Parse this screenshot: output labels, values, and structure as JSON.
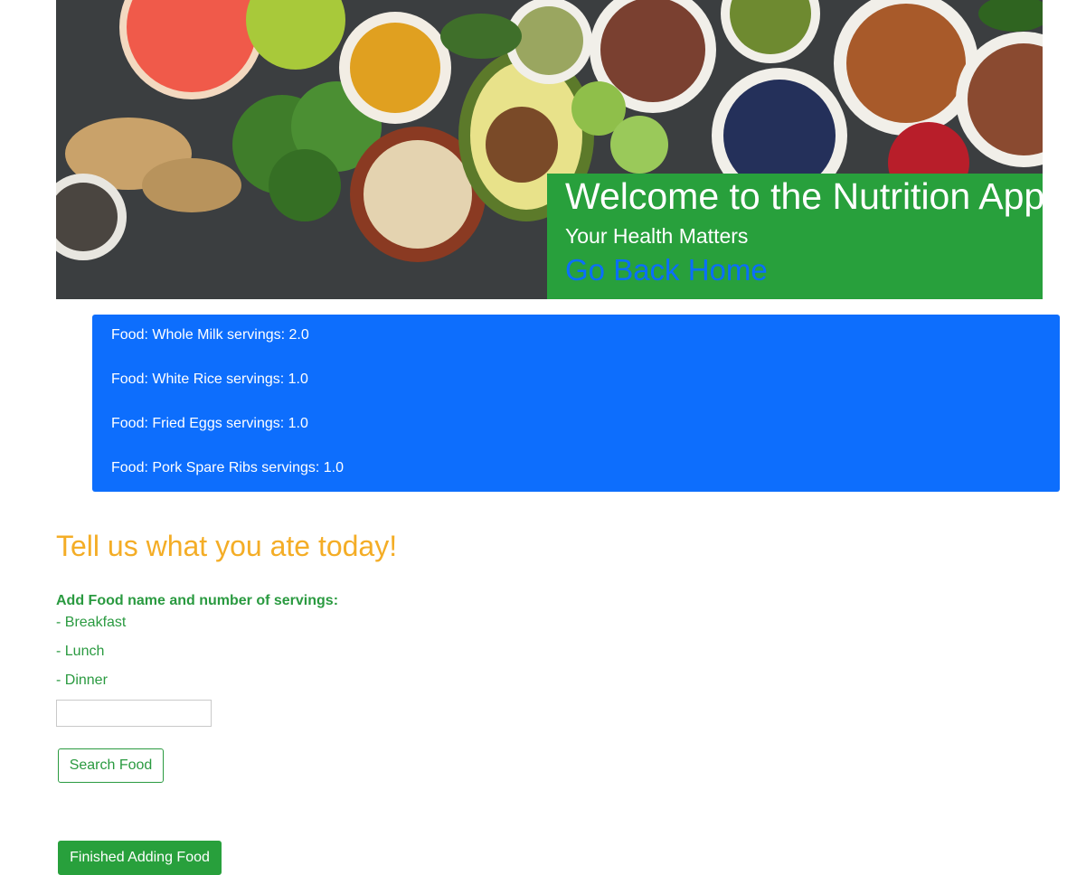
{
  "hero": {
    "image_description": "Assortment of healthy foods: grapefruit, apple, turmeric, spinach, greens powder, flax seeds, mung beans, almonds, broccoli, oats, avocado, brussels sprouts, blueberries, pomegranate, ginger, chia seeds",
    "title": "Welcome to the Nutrition App",
    "subtitle": "Your Health Matters",
    "home_link": "Go Back Home"
  },
  "food_list": {
    "items": [
      "Food: Whole Milk servings: 2.0",
      "Food: White Rice servings: 1.0",
      "Food: Fried Eggs servings: 1.0",
      "Food: Pork Spare Ribs servings: 1.0"
    ]
  },
  "form": {
    "heading": "Tell us what you ate today!",
    "label": "Add Food name and number of servings:",
    "meals": [
      "- Breakfast",
      "- Lunch",
      "- Dinner"
    ],
    "input_value": "",
    "search_button": "Search Food",
    "finish_button": "Finished Adding Food"
  },
  "colors": {
    "green": "#28a03c",
    "blue": "#0d6efd",
    "orange": "#f4ad26",
    "link_blue": "#0a6efd"
  }
}
